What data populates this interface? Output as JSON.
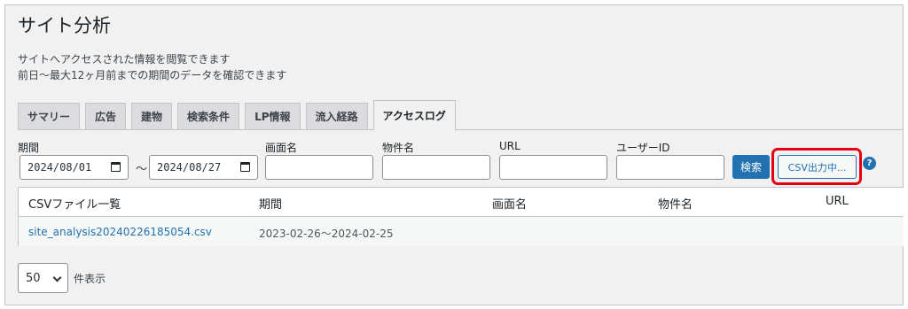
{
  "page": {
    "title": "サイト分析",
    "description_line1": "サイトへアクセスされた情報を閲覧できます",
    "description_line2": "前日〜最大12ヶ月前までの期間のデータを確認できます"
  },
  "tabs": [
    {
      "label": "サマリー",
      "active": false
    },
    {
      "label": "広告",
      "active": false
    },
    {
      "label": "建物",
      "active": false
    },
    {
      "label": "検索条件",
      "active": false
    },
    {
      "label": "LP情報",
      "active": false
    },
    {
      "label": "流入経路",
      "active": false
    },
    {
      "label": "アクセスログ",
      "active": true
    }
  ],
  "filters": {
    "period_label": "期間",
    "date_from": "2024/08/01",
    "date_separator": "〜",
    "date_to": "2024/08/27",
    "screen_name_label": "画面名",
    "property_name_label": "物件名",
    "url_label": "URL",
    "user_id_label": "ユーザーID",
    "search_button": "検索",
    "csv_button": "CSV出力中...",
    "help_icon": "?"
  },
  "table": {
    "headers": [
      "CSVファイル一覧",
      "期間",
      "画面名",
      "物件名",
      "URL"
    ],
    "rows": [
      {
        "file": "site_analysis20240226185054.csv",
        "period": "2023-02-26〜2024-02-25",
        "screen": "",
        "property": "",
        "url": ""
      }
    ]
  },
  "pagination": {
    "per_page_value": "50",
    "per_page_label": "件表示"
  },
  "colors": {
    "accent": "#2271b1",
    "highlight": "#e50012"
  }
}
